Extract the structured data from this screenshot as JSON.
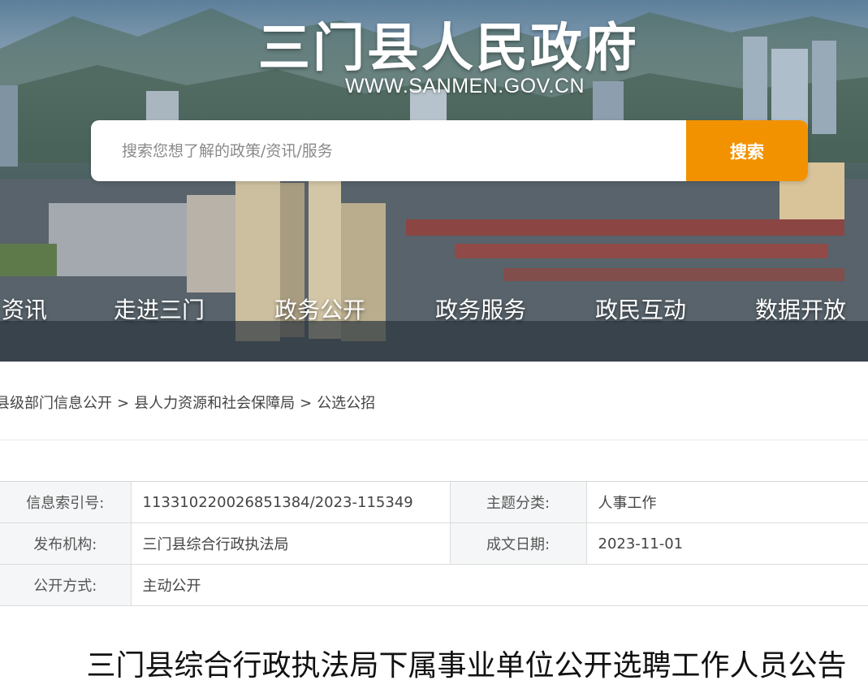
{
  "header": {
    "site_title": "三门县人民政府",
    "site_url": "WWW.SANMEN.GOV.CN"
  },
  "search": {
    "placeholder": "搜索您想了解的政策/资讯/服务",
    "button_label": "搜索"
  },
  "nav": {
    "items": [
      "资讯",
      "走进三门",
      "政务公开",
      "政务服务",
      "政民互动",
      "数据开放"
    ]
  },
  "breadcrumb": {
    "items": [
      "县级部门信息公开",
      "县人力资源和社会保障局",
      "公选公招"
    ],
    "separator": ">"
  },
  "info": {
    "index_label": "信息索引号:",
    "index_value": "113310220026851384/2023-115349",
    "topic_label": "主题分类:",
    "topic_value": "人事工作",
    "publisher_label": "发布机构:",
    "publisher_value": "三门县综合行政执法局",
    "date_label": "成文日期:",
    "date_value": "2023-11-01",
    "method_label": "公开方式:",
    "method_value": "主动公开"
  },
  "article": {
    "title": "三门县综合行政执法局下属事业单位公开选聘工作人员公告"
  },
  "colors": {
    "search_button": "#f39200",
    "table_label_bg": "#f5f6f7"
  }
}
